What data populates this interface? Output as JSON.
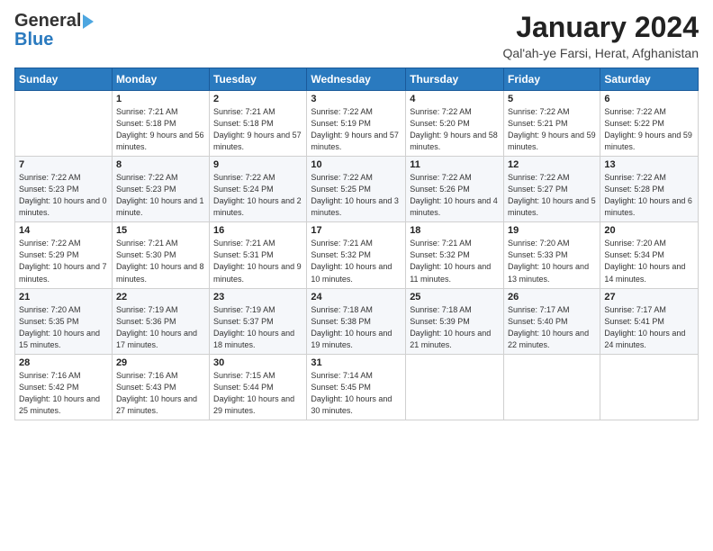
{
  "logo": {
    "line1": "General",
    "line2": "Blue"
  },
  "header": {
    "title": "January 2024",
    "location": "Qal'ah-ye Farsi, Herat, Afghanistan"
  },
  "weekdays": [
    "Sunday",
    "Monday",
    "Tuesday",
    "Wednesday",
    "Thursday",
    "Friday",
    "Saturday"
  ],
  "weeks": [
    [
      {
        "day": "",
        "sunrise": "",
        "sunset": "",
        "daylight": ""
      },
      {
        "day": "1",
        "sunrise": "Sunrise: 7:21 AM",
        "sunset": "Sunset: 5:18 PM",
        "daylight": "Daylight: 9 hours and 56 minutes."
      },
      {
        "day": "2",
        "sunrise": "Sunrise: 7:21 AM",
        "sunset": "Sunset: 5:18 PM",
        "daylight": "Daylight: 9 hours and 57 minutes."
      },
      {
        "day": "3",
        "sunrise": "Sunrise: 7:22 AM",
        "sunset": "Sunset: 5:19 PM",
        "daylight": "Daylight: 9 hours and 57 minutes."
      },
      {
        "day": "4",
        "sunrise": "Sunrise: 7:22 AM",
        "sunset": "Sunset: 5:20 PM",
        "daylight": "Daylight: 9 hours and 58 minutes."
      },
      {
        "day": "5",
        "sunrise": "Sunrise: 7:22 AM",
        "sunset": "Sunset: 5:21 PM",
        "daylight": "Daylight: 9 hours and 59 minutes."
      },
      {
        "day": "6",
        "sunrise": "Sunrise: 7:22 AM",
        "sunset": "Sunset: 5:22 PM",
        "daylight": "Daylight: 9 hours and 59 minutes."
      }
    ],
    [
      {
        "day": "7",
        "sunrise": "Sunrise: 7:22 AM",
        "sunset": "Sunset: 5:23 PM",
        "daylight": "Daylight: 10 hours and 0 minutes."
      },
      {
        "day": "8",
        "sunrise": "Sunrise: 7:22 AM",
        "sunset": "Sunset: 5:23 PM",
        "daylight": "Daylight: 10 hours and 1 minute."
      },
      {
        "day": "9",
        "sunrise": "Sunrise: 7:22 AM",
        "sunset": "Sunset: 5:24 PM",
        "daylight": "Daylight: 10 hours and 2 minutes."
      },
      {
        "day": "10",
        "sunrise": "Sunrise: 7:22 AM",
        "sunset": "Sunset: 5:25 PM",
        "daylight": "Daylight: 10 hours and 3 minutes."
      },
      {
        "day": "11",
        "sunrise": "Sunrise: 7:22 AM",
        "sunset": "Sunset: 5:26 PM",
        "daylight": "Daylight: 10 hours and 4 minutes."
      },
      {
        "day": "12",
        "sunrise": "Sunrise: 7:22 AM",
        "sunset": "Sunset: 5:27 PM",
        "daylight": "Daylight: 10 hours and 5 minutes."
      },
      {
        "day": "13",
        "sunrise": "Sunrise: 7:22 AM",
        "sunset": "Sunset: 5:28 PM",
        "daylight": "Daylight: 10 hours and 6 minutes."
      }
    ],
    [
      {
        "day": "14",
        "sunrise": "Sunrise: 7:22 AM",
        "sunset": "Sunset: 5:29 PM",
        "daylight": "Daylight: 10 hours and 7 minutes."
      },
      {
        "day": "15",
        "sunrise": "Sunrise: 7:21 AM",
        "sunset": "Sunset: 5:30 PM",
        "daylight": "Daylight: 10 hours and 8 minutes."
      },
      {
        "day": "16",
        "sunrise": "Sunrise: 7:21 AM",
        "sunset": "Sunset: 5:31 PM",
        "daylight": "Daylight: 10 hours and 9 minutes."
      },
      {
        "day": "17",
        "sunrise": "Sunrise: 7:21 AM",
        "sunset": "Sunset: 5:32 PM",
        "daylight": "Daylight: 10 hours and 10 minutes."
      },
      {
        "day": "18",
        "sunrise": "Sunrise: 7:21 AM",
        "sunset": "Sunset: 5:32 PM",
        "daylight": "Daylight: 10 hours and 11 minutes."
      },
      {
        "day": "19",
        "sunrise": "Sunrise: 7:20 AM",
        "sunset": "Sunset: 5:33 PM",
        "daylight": "Daylight: 10 hours and 13 minutes."
      },
      {
        "day": "20",
        "sunrise": "Sunrise: 7:20 AM",
        "sunset": "Sunset: 5:34 PM",
        "daylight": "Daylight: 10 hours and 14 minutes."
      }
    ],
    [
      {
        "day": "21",
        "sunrise": "Sunrise: 7:20 AM",
        "sunset": "Sunset: 5:35 PM",
        "daylight": "Daylight: 10 hours and 15 minutes."
      },
      {
        "day": "22",
        "sunrise": "Sunrise: 7:19 AM",
        "sunset": "Sunset: 5:36 PM",
        "daylight": "Daylight: 10 hours and 17 minutes."
      },
      {
        "day": "23",
        "sunrise": "Sunrise: 7:19 AM",
        "sunset": "Sunset: 5:37 PM",
        "daylight": "Daylight: 10 hours and 18 minutes."
      },
      {
        "day": "24",
        "sunrise": "Sunrise: 7:18 AM",
        "sunset": "Sunset: 5:38 PM",
        "daylight": "Daylight: 10 hours and 19 minutes."
      },
      {
        "day": "25",
        "sunrise": "Sunrise: 7:18 AM",
        "sunset": "Sunset: 5:39 PM",
        "daylight": "Daylight: 10 hours and 21 minutes."
      },
      {
        "day": "26",
        "sunrise": "Sunrise: 7:17 AM",
        "sunset": "Sunset: 5:40 PM",
        "daylight": "Daylight: 10 hours and 22 minutes."
      },
      {
        "day": "27",
        "sunrise": "Sunrise: 7:17 AM",
        "sunset": "Sunset: 5:41 PM",
        "daylight": "Daylight: 10 hours and 24 minutes."
      }
    ],
    [
      {
        "day": "28",
        "sunrise": "Sunrise: 7:16 AM",
        "sunset": "Sunset: 5:42 PM",
        "daylight": "Daylight: 10 hours and 25 minutes."
      },
      {
        "day": "29",
        "sunrise": "Sunrise: 7:16 AM",
        "sunset": "Sunset: 5:43 PM",
        "daylight": "Daylight: 10 hours and 27 minutes."
      },
      {
        "day": "30",
        "sunrise": "Sunrise: 7:15 AM",
        "sunset": "Sunset: 5:44 PM",
        "daylight": "Daylight: 10 hours and 29 minutes."
      },
      {
        "day": "31",
        "sunrise": "Sunrise: 7:14 AM",
        "sunset": "Sunset: 5:45 PM",
        "daylight": "Daylight: 10 hours and 30 minutes."
      },
      {
        "day": "",
        "sunrise": "",
        "sunset": "",
        "daylight": ""
      },
      {
        "day": "",
        "sunrise": "",
        "sunset": "",
        "daylight": ""
      },
      {
        "day": "",
        "sunrise": "",
        "sunset": "",
        "daylight": ""
      }
    ]
  ]
}
